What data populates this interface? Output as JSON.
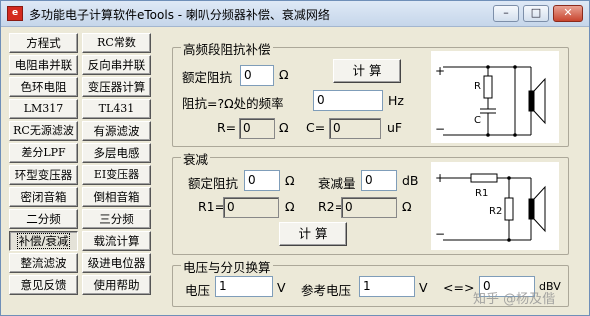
{
  "window": {
    "icon_text": "e",
    "title": "多功能电子计算软件eTools - 喇叭分频器补偿、衰减网络",
    "minimize": "–",
    "maximize": "□",
    "close": "✕"
  },
  "menu": [
    "方程式",
    "RC常数",
    "电阻串并联",
    "反向串并联",
    "色环电阻",
    "变压器计算",
    "LM317",
    "TL431",
    "RC无源滤波",
    "有源滤波",
    "差分LPF",
    "多层电感",
    "环型变压器",
    "EI变压器",
    "密闭音箱",
    "倒相音箱",
    "二分频",
    "三分频",
    "补偿/衰减",
    "载流计算",
    "整流滤波",
    "级进电位器",
    "意见反馈",
    "使用帮助"
  ],
  "hf": {
    "title": "高频段阻抗补偿",
    "rated_label": "额定阻抗",
    "rated_value": "0",
    "rated_unit": "Ω",
    "calc": "计 算",
    "freq_label": "阻抗=?Ω处的频率",
    "freq_value": "0",
    "freq_unit": "Hz",
    "r_label": "R=",
    "r_value": "0",
    "r_unit": "Ω",
    "c_label": "C=",
    "c_value": "0",
    "c_unit": "uF",
    "diagram": {
      "plus": "+",
      "minus": "−",
      "r": "R",
      "c": "C"
    }
  },
  "att": {
    "title": "衰减",
    "rated_label": "额定阻抗",
    "rated_value": "0",
    "rated_unit": "Ω",
    "amount_label": "衰减量",
    "amount_value": "0",
    "amount_unit": "dB",
    "r1_label": "R1=",
    "r1_value": "0",
    "r1_unit": "Ω",
    "r2_label": "R2=",
    "r2_value": "0",
    "r2_unit": "Ω",
    "calc": "计 算",
    "diagram": {
      "plus": "+",
      "minus": "−",
      "r1": "R1",
      "r2": "R2"
    }
  },
  "db": {
    "title": "电压与分贝换算",
    "v_label": "电压",
    "v_value": "1",
    "v_unit": "V",
    "ref_label": "参考电压",
    "ref_value": "1",
    "ref_unit": "V",
    "arrow": "<=>",
    "db_value": "0",
    "db_unit": "dBV"
  },
  "watermark": "知乎 @杨及偕"
}
